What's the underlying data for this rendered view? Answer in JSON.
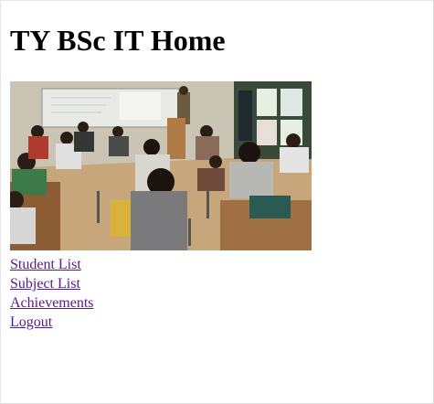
{
  "page": {
    "title": "TY BSc IT Home"
  },
  "image": {
    "icon": "classroom-photo",
    "description_alt": "classroom"
  },
  "nav": {
    "links": [
      {
        "label": "Student List"
      },
      {
        "label": "Subject List"
      },
      {
        "label": "Achievements"
      },
      {
        "label": "Logout"
      }
    ]
  },
  "colors": {
    "link_visited": "#551a8b"
  }
}
